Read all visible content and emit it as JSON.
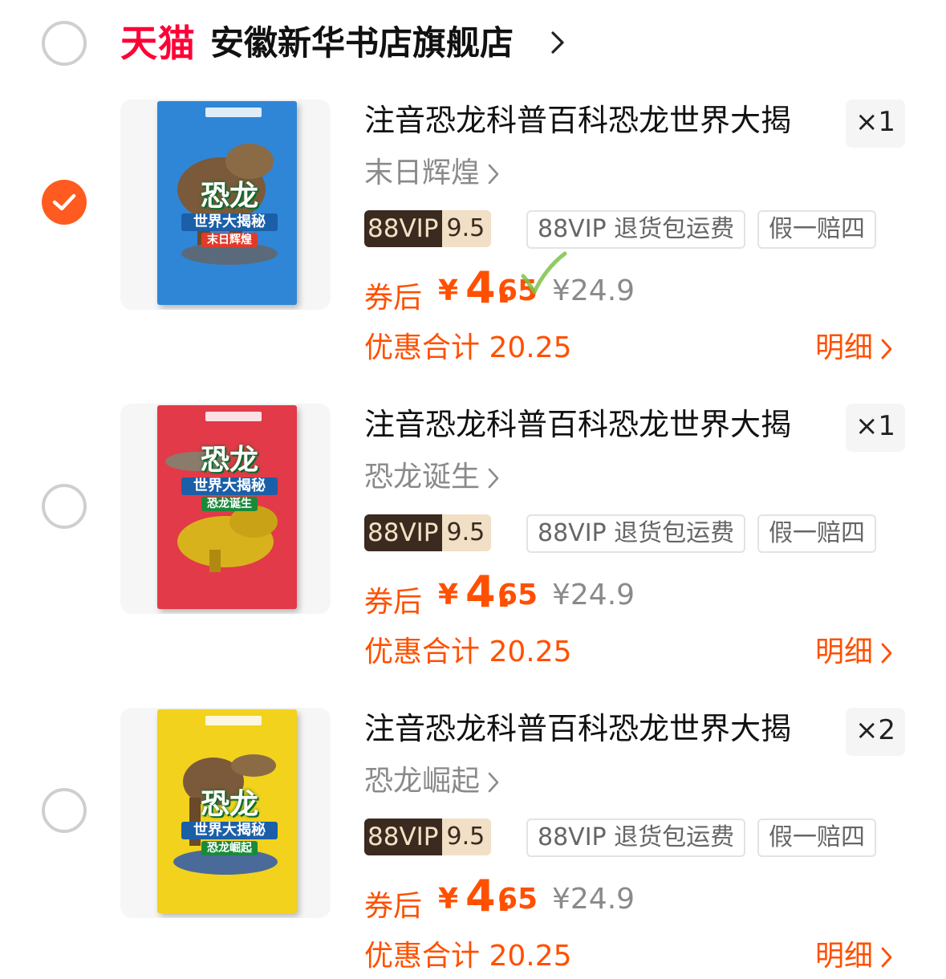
{
  "store": {
    "platform": "天猫",
    "name": "安徽新华书店旗舰店",
    "selected": false
  },
  "items": [
    {
      "selected": true,
      "title": "注音恐龙科普百科恐龙世界大揭",
      "quantity": "×1",
      "variant": "末日辉煌",
      "vip_label": "88VIP",
      "vip_discount": "9.5折",
      "tag_return": "88VIP 退货包运费",
      "tag_guarantee": "假一赔四",
      "after_coupon_label": "券后",
      "currency": "¥",
      "price_int": "4.",
      "price_dec": "65",
      "original_price": "¥24.9",
      "discount_total": "优惠合计 20.25",
      "detail_label": "明细",
      "cover_color": "#2f86d6",
      "cover_title": "恐龙",
      "cover_subtitle": "世界大揭秘",
      "cover_volume": "末日辉煌"
    },
    {
      "selected": false,
      "title": "注音恐龙科普百科恐龙世界大揭",
      "quantity": "×1",
      "variant": "恐龙诞生",
      "vip_label": "88VIP",
      "vip_discount": "9.5折",
      "tag_return": "88VIP 退货包运费",
      "tag_guarantee": "假一赔四",
      "after_coupon_label": "券后",
      "currency": "¥",
      "price_int": "4.",
      "price_dec": "65",
      "original_price": "¥24.9",
      "discount_total": "优惠合计 20.25",
      "detail_label": "明细",
      "cover_color": "#e23a48",
      "cover_title": "恐龙",
      "cover_subtitle": "世界大揭秘",
      "cover_volume": "恐龙诞生"
    },
    {
      "selected": false,
      "title": "注音恐龙科普百科恐龙世界大揭",
      "quantity": "×2",
      "variant": "恐龙崛起",
      "vip_label": "88VIP",
      "vip_discount": "9.5折",
      "tag_return": "88VIP 退货包运费",
      "tag_guarantee": "假一赔四",
      "after_coupon_label": "券后",
      "currency": "¥",
      "price_int": "4.",
      "price_dec": "65",
      "original_price": "¥24.9",
      "discount_total": "优惠合计 20.25",
      "detail_label": "明细",
      "cover_color": "#f2d21c",
      "cover_title": "恐龙",
      "cover_subtitle": "世界大揭秘",
      "cover_volume": "恐龙崛起"
    }
  ],
  "colors": {
    "accent": "#ff5000",
    "checkbox_selected": "#ff5a1f",
    "tmall_red": "#ff0036",
    "vip_dark": "#3b2a20",
    "vip_light": "#f1dfc6"
  }
}
